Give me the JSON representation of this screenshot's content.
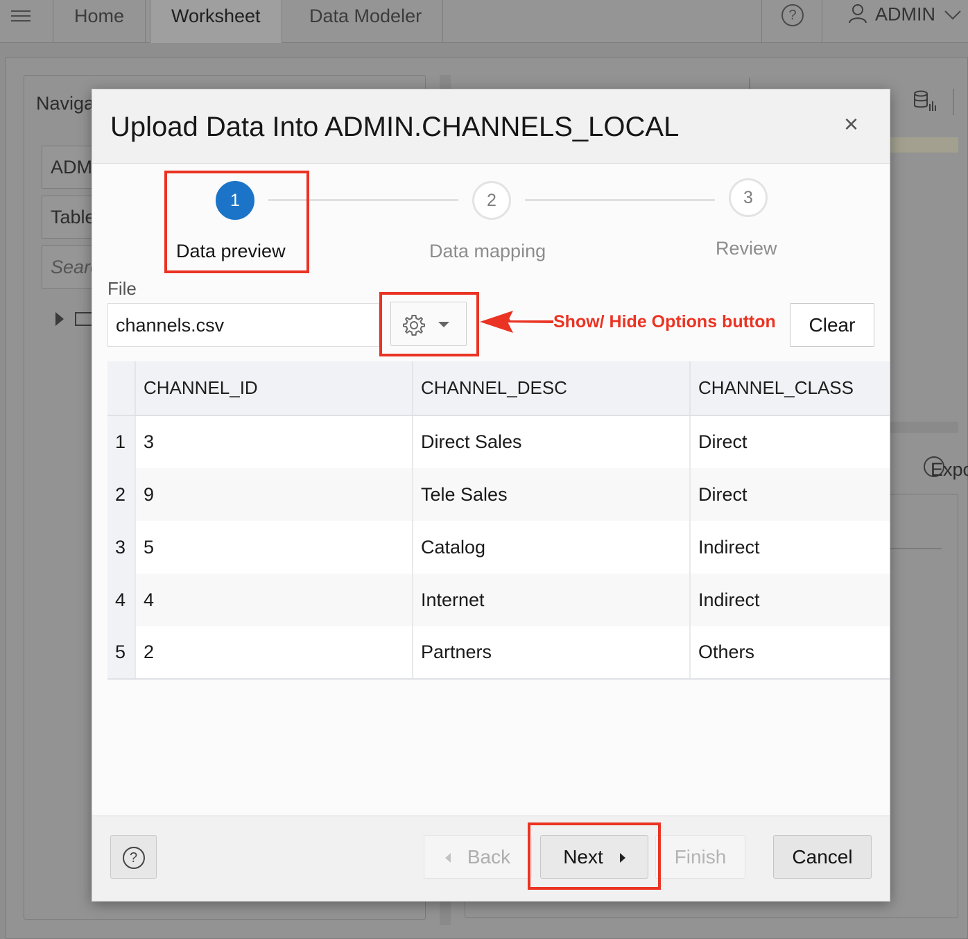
{
  "app": {
    "nav_tabs": [
      {
        "label": "Home"
      },
      {
        "label": "Worksheet"
      },
      {
        "label": "Data Modeler"
      }
    ],
    "help_glyph": "?",
    "user_label": "ADMIN",
    "navigator": {
      "title": "Navigator",
      "schema_value": "ADMIN",
      "object_type": "Tables",
      "search_placeholder": "Search"
    },
    "right_panel": {
      "export_label": "Export"
    }
  },
  "dialog": {
    "title": "Upload Data Into ADMIN.CHANNELS_LOCAL",
    "close_glyph": "×",
    "steps": [
      {
        "number": "1",
        "label": "Data preview",
        "state": "active"
      },
      {
        "number": "2",
        "label": "Data mapping",
        "state": "todo"
      },
      {
        "number": "3",
        "label": "Review",
        "state": "todo"
      }
    ],
    "file": {
      "label": "File",
      "value": "channels.csv"
    },
    "options_button_icon": "gear-icon",
    "clear_label": "Clear",
    "annotation": "Show/ Hide Options button",
    "table": {
      "columns": [
        "CHANNEL_ID",
        "CHANNEL_DESC",
        "CHANNEL_CLASS"
      ],
      "rows": [
        {
          "n": "1",
          "cells": [
            "3",
            "Direct Sales",
            "Direct"
          ]
        },
        {
          "n": "2",
          "cells": [
            "9",
            "Tele Sales",
            "Direct"
          ]
        },
        {
          "n": "3",
          "cells": [
            "5",
            "Catalog",
            "Indirect"
          ]
        },
        {
          "n": "4",
          "cells": [
            "4",
            "Internet",
            "Indirect"
          ]
        },
        {
          "n": "5",
          "cells": [
            "2",
            "Partners",
            "Others"
          ]
        }
      ]
    },
    "footer": {
      "help_glyph": "?",
      "back_label": "Back",
      "next_label": "Next",
      "finish_label": "Finish",
      "cancel_label": "Cancel"
    }
  },
  "colors": {
    "accent_blue": "#1b74c7",
    "annotation_red": "#ea3323"
  }
}
